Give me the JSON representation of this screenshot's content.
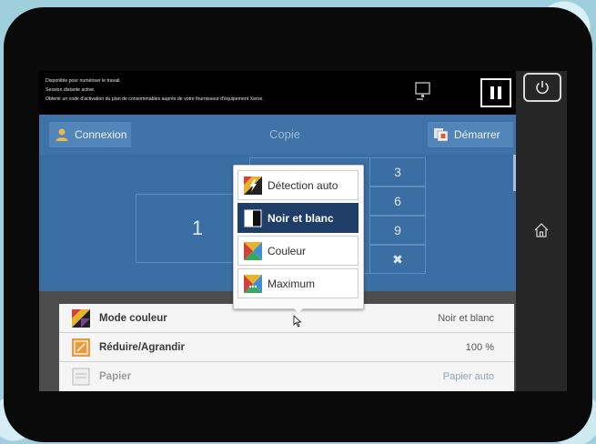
{
  "status": {
    "lines": [
      "Disponible pour numériser le travail.",
      "Session distante active.",
      "Obtenir un code d'activation du plan de consommables auprès de votre fournisseur d'équipement Xerox."
    ]
  },
  "titlebar": {
    "login_label": "Connexion",
    "title": "Copie",
    "start_label": "Démarrer"
  },
  "quantity": {
    "value": "1"
  },
  "keypad": {
    "keys": [
      "3",
      "6",
      "9",
      "✖"
    ]
  },
  "color_menu": {
    "options": [
      {
        "label": "Détection auto",
        "icon": "auto-detect-icon"
      },
      {
        "label": "Noir et blanc",
        "icon": "black-white-icon",
        "selected": true
      },
      {
        "label": "Couleur",
        "icon": "color-icon"
      },
      {
        "label": "Maximum",
        "icon": "maximum-icon"
      }
    ]
  },
  "settings": {
    "rows": [
      {
        "label": "Mode couleur",
        "value": "Noir et blanc",
        "icon": "color-mode-icon"
      },
      {
        "label": "Réduire/Agrandir",
        "value": "100 %",
        "icon": "resize-icon"
      },
      {
        "label": "Papier",
        "value": "Papier auto",
        "icon": "paper-icon"
      }
    ]
  },
  "colors": {
    "title_bar": "#3f72a6",
    "main_area": "#3b6ea3",
    "selected_option": "#1e3e68"
  }
}
